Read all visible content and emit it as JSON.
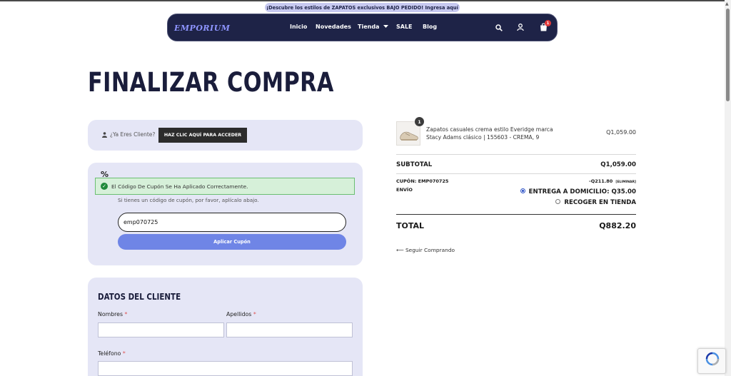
{
  "announcement": "¡Descubre los estilos de ZAPATOS exclusivos BAJO PEDIDO! Ingresa aquí",
  "nav": {
    "logo": "EMPORIUM",
    "links": [
      "Inicio",
      "Novedades",
      "Tienda",
      "SALE",
      "Blog"
    ],
    "cart_count": "1"
  },
  "page_title": "FINALIZAR COMPRA",
  "login": {
    "prompt": "¿Ya Eres Cliente?",
    "button": "HAZ CLIC AQUÍ PARA ACCEDER"
  },
  "coupon": {
    "symbol": "%",
    "success": "El Código De Cupón Se Ha Aplicado Correctamente.",
    "hint": "Si tienes un código de cupón, por favor, aplícalo abajo.",
    "value": "emp070725",
    "button": "Aplicar Cupón"
  },
  "client": {
    "title": "DATOS DEL CLIENTE",
    "first_name_label": "Nombres",
    "last_name_label": "Apellidos",
    "phone_label": "Teléfono",
    "required_mark": "*"
  },
  "order": {
    "qty": "1",
    "product_name": "Zapatos casuales crema estilo Everidge marca Stacy Adams clásico | 155603 - CREMA, 9",
    "product_price": "Q1,059.00",
    "subtotal_label": "SUBTOTAL",
    "subtotal_value": "Q1,059.00",
    "coupon_label": "CUPÓN: EMP070725",
    "coupon_value": "-Q211.80",
    "coupon_remove": "[ELIMINAR]",
    "shipping_label": "ENVÍO",
    "shipping_options": [
      "ENTREGA A DOMICILIO: Q35.00",
      "RECOGER EN TIENDA"
    ],
    "total_label": "TOTAL",
    "total_value": "Q882.20",
    "back_link": "Seguir Comprando"
  },
  "colors": {
    "navy": "#1e2347",
    "card": "#e5e6f6",
    "accent": "#6f85e6",
    "success": "#d6f0d9"
  }
}
